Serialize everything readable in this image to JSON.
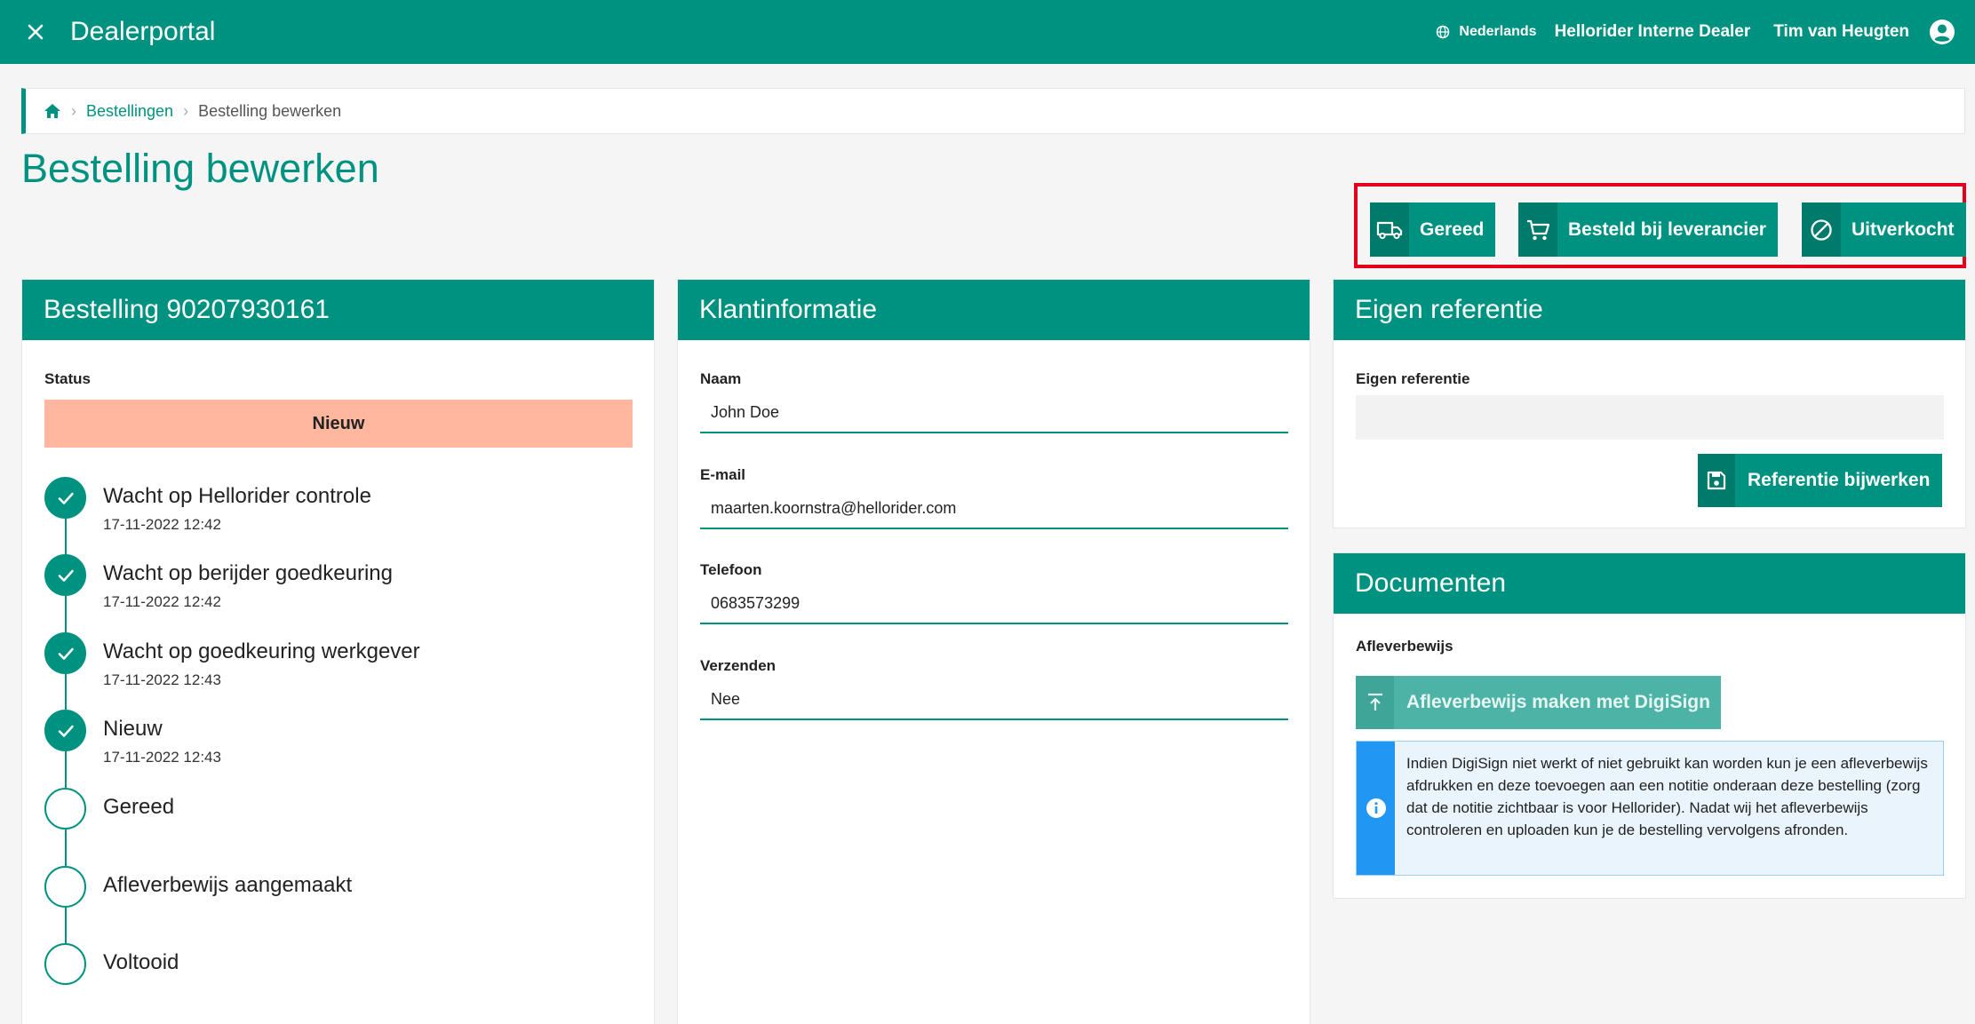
{
  "header": {
    "title": "Dealerportal",
    "language": "Nederlands",
    "dealer": "Hellorider Interne Dealer",
    "user": "Tim van Heugten"
  },
  "breadcrumb": {
    "orders": "Bestellingen",
    "current": "Bestelling bewerken"
  },
  "page": {
    "title": "Bestelling bewerken"
  },
  "actions": {
    "ready": "Gereed",
    "ordered": "Besteld bij leverancier",
    "sold_out": "Uitverkocht"
  },
  "order": {
    "heading": "Bestelling 90207930161",
    "status_label": "Status",
    "status_value": "Nieuw",
    "steps": [
      {
        "title": "Wacht op Hellorider controle",
        "date": "17-11-2022 12:42"
      },
      {
        "title": "Wacht op berijder goedkeuring",
        "date": "17-11-2022 12:42"
      },
      {
        "title": "Wacht op goedkeuring werkgever",
        "date": "17-11-2022 12:43"
      },
      {
        "title": "Nieuw",
        "date": "17-11-2022 12:43"
      },
      {
        "title": "Gereed",
        "date": ""
      },
      {
        "title": "Afleverbewijs aangemaakt",
        "date": ""
      },
      {
        "title": "Voltooid",
        "date": ""
      }
    ]
  },
  "customer": {
    "heading": "Klantinformatie",
    "name_label": "Naam",
    "name_value": "John Doe",
    "email_label": "E-mail",
    "email_value": "maarten.koornstra@hellorider.com",
    "phone_label": "Telefoon",
    "phone_value": "0683573299",
    "ship_label": "Verzenden",
    "ship_value": "Nee"
  },
  "reference": {
    "heading": "Eigen referentie",
    "field_label": "Eigen referentie",
    "field_value": "",
    "button": "Referentie bijwerken"
  },
  "documents": {
    "heading": "Documenten",
    "section_label": "Afleverbewijs",
    "digisign_button": "Afleverbewijs maken met DigiSign",
    "info_text": "Indien DigiSign niet werkt of niet gebruikt kan worden kun je een afleverbewijs afdrukken en deze toevoegen aan een notitie onderaan deze bestelling (zorg dat de notitie zichtbaar is voor Hellorider). Nadat wij het afleverbewijs controleren en uploaden kun je de bestelling vervolgens afronden."
  },
  "colors": {
    "primary": "#009280",
    "status_badge": "#ffb79f",
    "highlight": "#e3001b",
    "info": "#2196f3"
  }
}
